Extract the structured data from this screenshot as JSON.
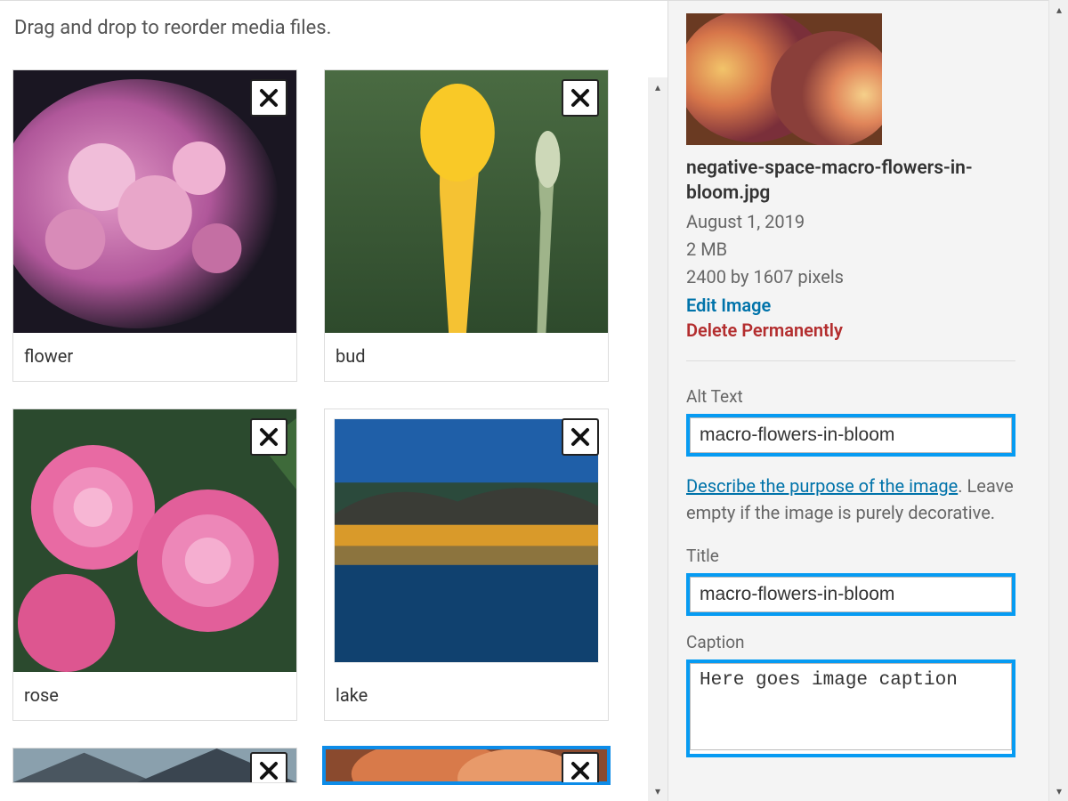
{
  "instruction": "Drag and drop to reorder media files.",
  "media": [
    {
      "caption": "flower",
      "selected": false
    },
    {
      "caption": "bud",
      "selected": false
    },
    {
      "caption": "rose",
      "selected": false
    },
    {
      "caption": "lake",
      "selected": false
    },
    {
      "caption": "",
      "selected": false
    },
    {
      "caption": "",
      "selected": true
    }
  ],
  "details": {
    "filename": "negative-space-macro-flowers-in-bloom.jpg",
    "date": "August 1, 2019",
    "size": "2 MB",
    "dimensions": "2400 by 1607 pixels",
    "edit_label": "Edit Image",
    "delete_label": "Delete Permanently"
  },
  "fields": {
    "alt_label": "Alt Text",
    "alt_value": "macro-flowers-in-bloom",
    "describe_link": "Describe the purpose of the image",
    "describe_suffix": ".",
    "help_text": "Leave empty if the image is purely decorative.",
    "title_label": "Title",
    "title_value": "macro-flowers-in-bloom",
    "caption_label": "Caption",
    "caption_value": "Here goes image caption"
  }
}
